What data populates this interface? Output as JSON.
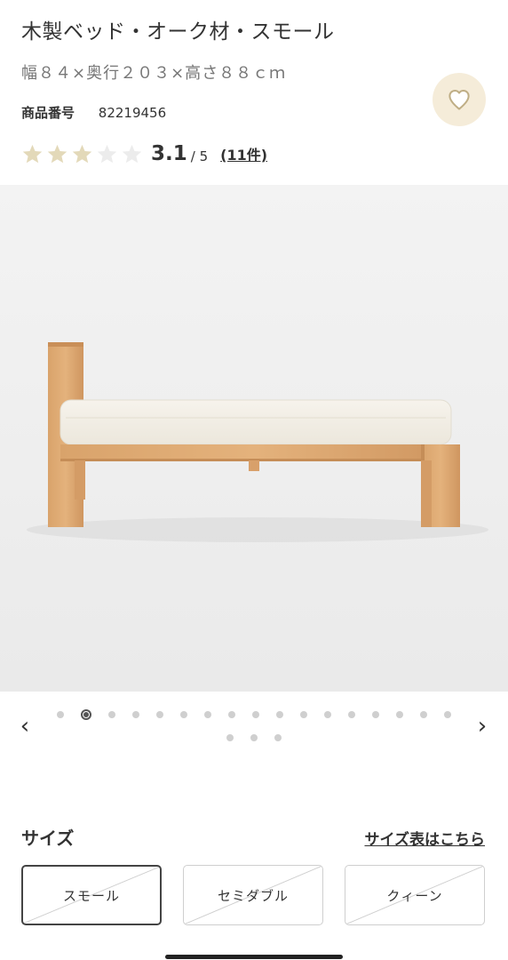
{
  "product": {
    "title": "木製ベッド・オーク材・スモール",
    "dimensions": "幅８４×奥行２０３×高さ８８ｃｍ",
    "code_label": "商品番号",
    "code_value": "82219456"
  },
  "favorite": {
    "icon": "heart-icon",
    "bg_color": "#f5ecd9"
  },
  "rating": {
    "value": 3.1,
    "max": 5,
    "score_text": "3.1",
    "outof_text": "/ 5",
    "count_text": "(11件)",
    "star_filled_color": "#e3d9b9",
    "star_empty_color": "#ececec"
  },
  "gallery": {
    "image": "oak-bed-photo",
    "total_images": 20,
    "active_index": 1,
    "prev_icon": "chevron-left-icon",
    "next_icon": "chevron-right-icon",
    "prev_glyph": "‹",
    "next_glyph": "›"
  },
  "size": {
    "label": "サイズ",
    "guide_link": "サイズ表はこちら",
    "options": [
      {
        "label": "スモール",
        "selected": true
      },
      {
        "label": "セミダブル",
        "selected": false
      },
      {
        "label": "クィーン",
        "selected": false
      }
    ]
  }
}
